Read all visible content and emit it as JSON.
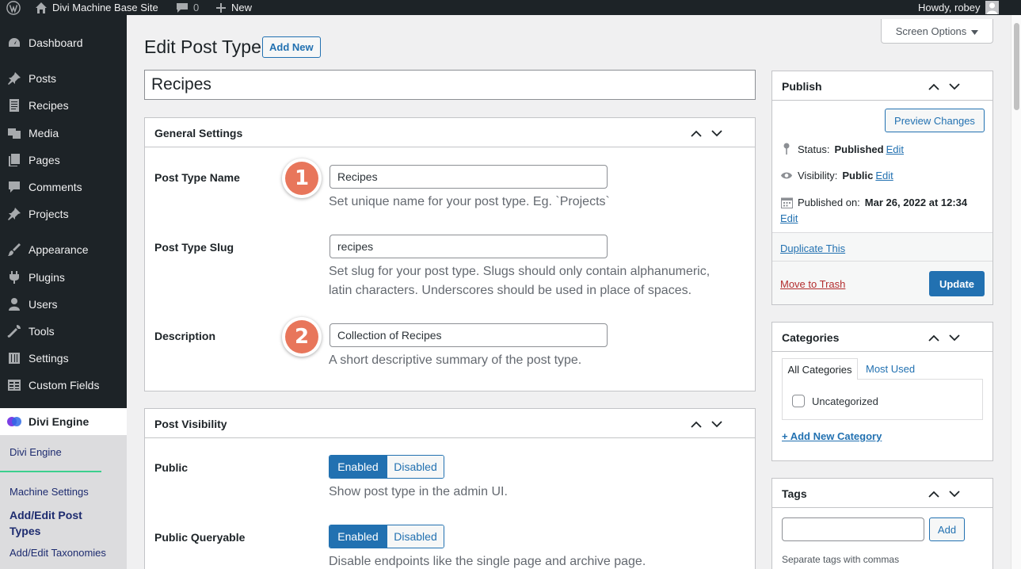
{
  "admin_bar": {
    "site_name": "Divi Machine Base Site",
    "comments_count": "0",
    "new_label": "New",
    "greeting": "Howdy, robey"
  },
  "sidebar": {
    "items": [
      {
        "label": "Dashboard",
        "icon": "dashboard-icon"
      },
      {
        "label": "Posts",
        "icon": "pin-icon"
      },
      {
        "label": "Recipes",
        "icon": "document-icon"
      },
      {
        "label": "Media",
        "icon": "media-icon"
      },
      {
        "label": "Pages",
        "icon": "pages-icon"
      },
      {
        "label": "Comments",
        "icon": "comment-icon"
      },
      {
        "label": "Projects",
        "icon": "pin-icon"
      },
      {
        "label": "Appearance",
        "icon": "brush-icon"
      },
      {
        "label": "Plugins",
        "icon": "plugin-icon"
      },
      {
        "label": "Users",
        "icon": "user-icon"
      },
      {
        "label": "Tools",
        "icon": "wrench-icon"
      },
      {
        "label": "Settings",
        "icon": "settings-icon"
      },
      {
        "label": "Custom Fields",
        "icon": "table-icon"
      },
      {
        "label": "Divi Engine",
        "icon": "divi-engine-icon"
      }
    ],
    "submenu": {
      "divi_engine": "Divi Engine",
      "machine_settings": "Machine Settings",
      "add_edit_post_types": "Add/Edit Post Types",
      "add_edit_taxonomies": "Add/Edit Taxonomies"
    }
  },
  "header": {
    "screen_options": "Screen Options",
    "title": "Edit Post Type",
    "add_new": "Add New"
  },
  "post_title": "Recipes",
  "general_settings": {
    "title": "General Settings",
    "post_type_name_label": "Post Type Name",
    "post_type_name_value": "Recipes",
    "post_type_name_help": "Set unique name for your post type. Eg. `Projects`",
    "slug_label": "Post Type Slug",
    "slug_value": "recipes",
    "slug_help_1": "Set slug for your post type. Slugs should only contain alphanumeric,",
    "slug_help_2": "latin characters. Underscores should be used in place of spaces.",
    "description_label": "Description",
    "description_value": "Collection of Recipes",
    "description_help": "A short descriptive summary of the post type.",
    "step_1": "1",
    "step_2": "2"
  },
  "post_visibility": {
    "title": "Post Visibility",
    "public_label": "Public",
    "public_help": "Show post type in the admin UI.",
    "queryable_label": "Public Queryable",
    "queryable_help": "Disable endpoints like the single page and archive page.",
    "enabled": "Enabled",
    "disabled": "Disabled"
  },
  "publish": {
    "title": "Publish",
    "preview_changes": "Preview Changes",
    "status_label": "Status:",
    "status_value": "Published",
    "visibility_label": "Visibility:",
    "visibility_value": "Public",
    "published_on_label": "Published on:",
    "published_on_value": "Mar 26, 2022 at 12:34",
    "edit": "Edit",
    "duplicate": "Duplicate This",
    "trash": "Move to Trash",
    "update": "Update"
  },
  "categories": {
    "title": "Categories",
    "tab_all": "All Categories",
    "tab_most_used": "Most Used",
    "uncategorized": "Uncategorized",
    "add_new": "+ Add New Category"
  },
  "tags": {
    "title": "Tags",
    "add": "Add",
    "help": "Separate tags with commas"
  },
  "colors": {
    "accent": "#2271b1",
    "admin_bar": "#1d2327",
    "step_badge": "#e8765b",
    "trash": "#b32d2e"
  }
}
